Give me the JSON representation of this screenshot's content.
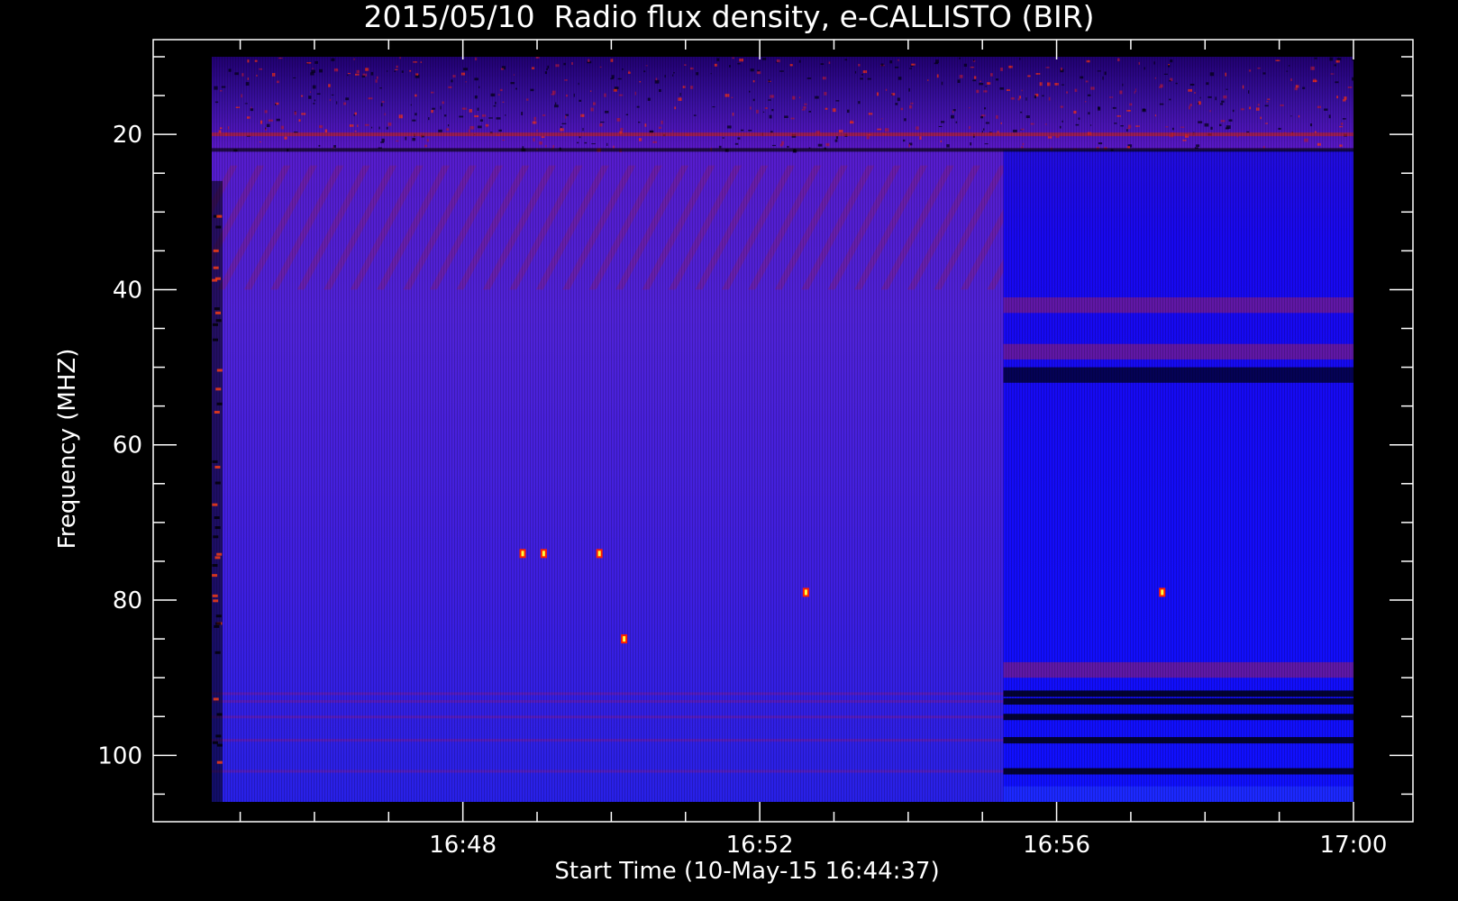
{
  "chart_data": {
    "type": "heatmap",
    "title": "2015/05/10  Radio flux density, e-CALLISTO (BIR)",
    "xlabel": "Start Time (10-May-15 16:44:37)",
    "ylabel": "Frequency (MHZ)",
    "x_start": "16:44:37",
    "x_range": [
      "16:44:37",
      "17:00:00"
    ],
    "y_range": [
      10,
      106
    ],
    "y_inverted": true,
    "x_ticks": [
      "16:48",
      "16:52",
      "16:56",
      "17:00"
    ],
    "y_ticks": [
      20,
      40,
      60,
      80,
      100
    ],
    "colors": {
      "background": "#000000",
      "axes": "#ffffff",
      "low": "#0000ff",
      "mid": "#5a18c8",
      "high": "#ff2000",
      "peak": "#ffff40"
    },
    "segment_change_time": "16:55:17",
    "rfi_bands_mhz": [
      20,
      22,
      92,
      93,
      95,
      98,
      102
    ],
    "bright_spots": [
      {
        "time": "16:48:48",
        "freq": 74
      },
      {
        "time": "16:49:05",
        "freq": 74
      },
      {
        "time": "16:49:50",
        "freq": 74
      },
      {
        "time": "16:52:37",
        "freq": 79
      },
      {
        "time": "16:50:10",
        "freq": 85
      },
      {
        "time": "16:57:25",
        "freq": 79
      }
    ]
  }
}
